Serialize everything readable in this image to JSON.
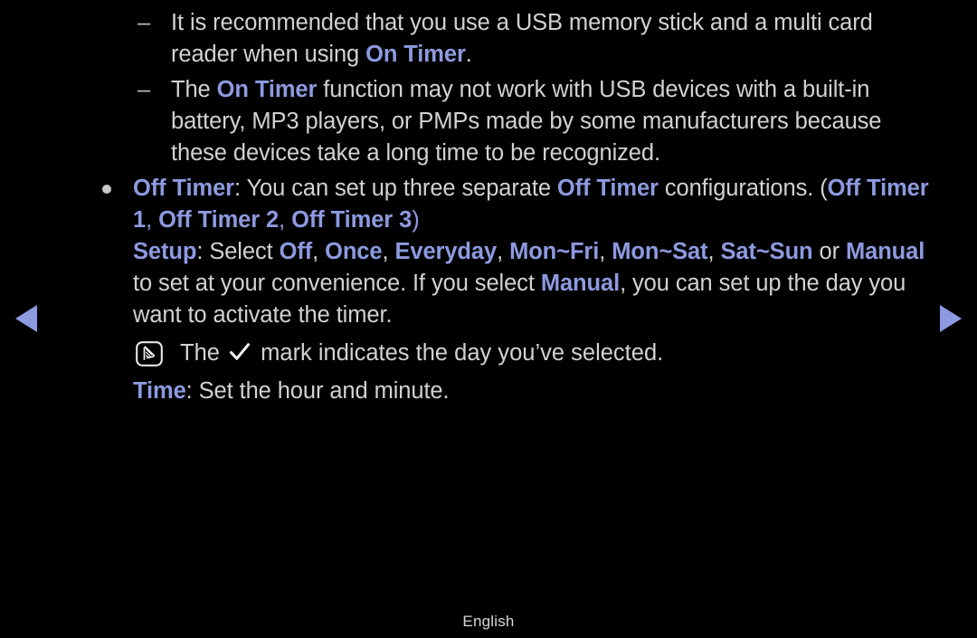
{
  "meta": {
    "background_color": "#000000",
    "body_text_color": "#d2d2d2",
    "highlight_color": "#8d9ae0"
  },
  "nav": {
    "prev_label": "previous page",
    "next_label": "next page"
  },
  "content": {
    "sub_items": [
      {
        "marker": "–",
        "segments": [
          {
            "text": "It is recommended that you use a USB memory stick and a multi card reader when using ",
            "style": "plain"
          },
          {
            "text": "On Timer",
            "style": "highlight"
          },
          {
            "text": ".",
            "style": "plain"
          }
        ]
      },
      {
        "marker": "–",
        "segments": [
          {
            "text": "The ",
            "style": "plain"
          },
          {
            "text": "On Timer",
            "style": "highlight"
          },
          {
            "text": " function may not work with USB devices with a built-in battery, MP3 players, or PMPs made by some manufacturers because these devices take a long time to be recognized.",
            "style": "plain"
          }
        ]
      }
    ],
    "main_item": {
      "marker": "•",
      "segments": [
        {
          "text": "Off Timer",
          "style": "highlight"
        },
        {
          "text": ": You can set up three separate ",
          "style": "plain"
        },
        {
          "text": "Off Timer",
          "style": "highlight"
        },
        {
          "text": " configurations. (",
          "style": "plain"
        },
        {
          "text": "Off Timer 1",
          "style": "highlight"
        },
        {
          "text": ", ",
          "style": "highlight-plain"
        },
        {
          "text": "Off Timer 2",
          "style": "highlight"
        },
        {
          "text": ", ",
          "style": "highlight-plain"
        },
        {
          "text": "Off Timer 3",
          "style": "highlight"
        },
        {
          "text": ")",
          "style": "highlight-plain"
        }
      ]
    },
    "setup_block": {
      "segments": [
        {
          "text": "Setup",
          "style": "highlight"
        },
        {
          "text": ": Select ",
          "style": "plain"
        },
        {
          "text": "Off",
          "style": "highlight"
        },
        {
          "text": ", ",
          "style": "plain"
        },
        {
          "text": "Once",
          "style": "highlight"
        },
        {
          "text": ", ",
          "style": "plain"
        },
        {
          "text": "Everyday",
          "style": "highlight"
        },
        {
          "text": ", ",
          "style": "plain"
        },
        {
          "text": "Mon~Fri",
          "style": "highlight"
        },
        {
          "text": ", ",
          "style": "plain"
        },
        {
          "text": "Mon~Sat",
          "style": "highlight"
        },
        {
          "text": ", ",
          "style": "plain"
        },
        {
          "text": "Sat~Sun",
          "style": "highlight"
        },
        {
          "text": " or ",
          "style": "plain"
        },
        {
          "text": "Manual",
          "style": "highlight"
        },
        {
          "text": " to set at your convenience. If you select ",
          "style": "plain"
        },
        {
          "text": "Manual",
          "style": "highlight"
        },
        {
          "text": ", you can set up the day you want to activate the timer.",
          "style": "plain"
        }
      ]
    },
    "note": {
      "icon_name": "note-memo-icon",
      "text_before": "The",
      "check_mark": "✓",
      "text_after": "mark indicates the day you’ve selected."
    },
    "time_block": {
      "segments": [
        {
          "text": "Time",
          "style": "highlight"
        },
        {
          "text": ": Set the hour and minute.",
          "style": "plain"
        }
      ]
    }
  },
  "footer": {
    "language": "English"
  }
}
